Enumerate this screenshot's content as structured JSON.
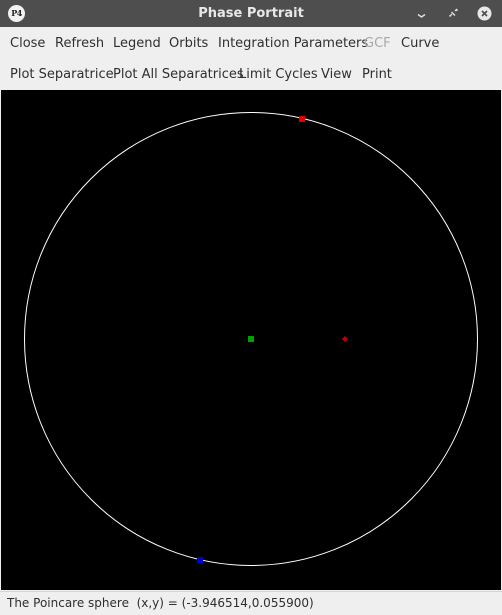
{
  "window": {
    "title": "Phase Portrait",
    "app_icon_text": "P4"
  },
  "icons": {
    "minimize": "minimize-icon",
    "restore": "restore-icon",
    "close": "close-icon"
  },
  "menu_row1": [
    {
      "label": "Close",
      "enabled": true
    },
    {
      "label": "Refresh",
      "enabled": true
    },
    {
      "label": "Legend",
      "enabled": true
    },
    {
      "label": "Orbits",
      "enabled": true
    },
    {
      "label": "Integration Parameters",
      "enabled": true
    },
    {
      "label": "GCF",
      "enabled": false
    },
    {
      "label": "Curve",
      "enabled": true
    }
  ],
  "menu_row2": [
    {
      "label": "Plot Separatrice",
      "enabled": true
    },
    {
      "label": "Plot All Separatrices",
      "enabled": true
    },
    {
      "label": "Limit Cycles",
      "enabled": true
    },
    {
      "label": "View",
      "enabled": true
    },
    {
      "label": "Print",
      "enabled": true
    }
  ],
  "plot": {
    "background": "#000000",
    "sphere_color": "#ffffff",
    "markers": [
      {
        "name": "green-point",
        "color": "#00a000",
        "shape": "square"
      },
      {
        "name": "red-point-top",
        "color": "#e00000",
        "shape": "square"
      },
      {
        "name": "red-point-right",
        "color": "#c00000",
        "shape": "diamond"
      },
      {
        "name": "blue-point-bottom",
        "color": "#0000d0",
        "shape": "square"
      }
    ]
  },
  "status": {
    "text": "The Poincare sphere  (x,y) = (-3.946514,0.055900)"
  }
}
